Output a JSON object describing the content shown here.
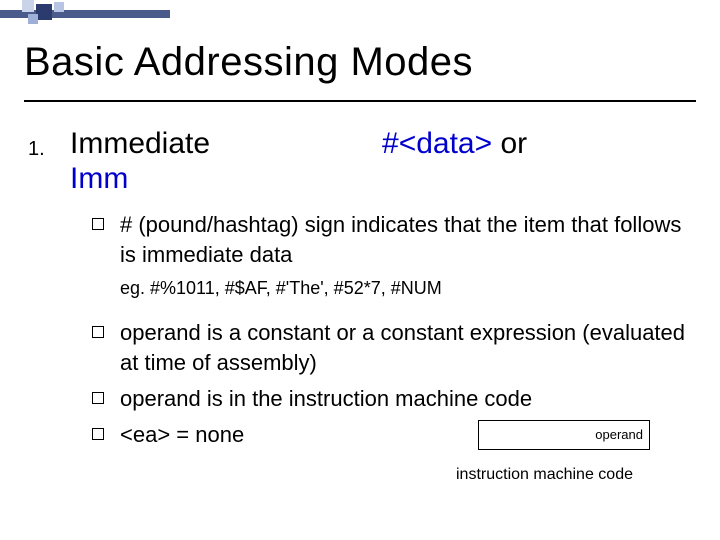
{
  "title": "Basic Addressing Modes",
  "list_number": "1.",
  "mode": {
    "name": "Immediate",
    "syntax_hash": "#",
    "syntax_lt": "<",
    "syntax_data": "data",
    "syntax_gt": ">",
    "syntax_or": " or",
    "abbr": "Imm"
  },
  "bullets": {
    "b1": "# (pound/hashtag) sign indicates that the item that follows is immediate data",
    "eg": "eg. #%1011,  #$AF,  #'The',  #52*7,  #NUM",
    "b2": "operand is a constant or a constant expression (evaluated at time of assembly)",
    "b3": "operand is in the instruction machine code",
    "b4": "<ea> = none"
  },
  "operand_label": "operand",
  "caption": "instruction machine code"
}
